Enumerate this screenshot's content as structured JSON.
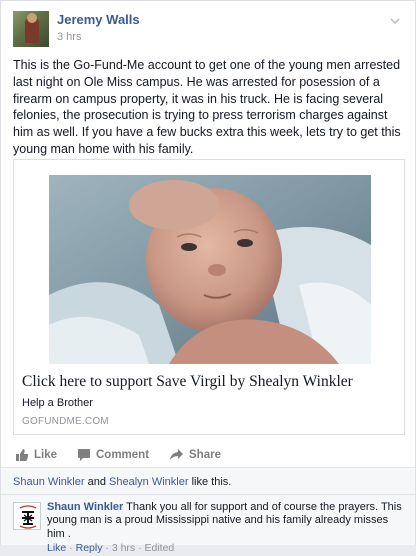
{
  "post": {
    "author": "Jeremy Walls",
    "time": "3 hrs",
    "text": "This is the Go-Fund-Me account to get one of the young men arrested last night on Ole Miss campus. He was arrested for posession of a firearm on campus property, it was in his truck. He is facing several felonies, the prosecution is trying to press terrorism charges against him as well. If you have a few bucks extra this week, lets try to get this young man home with his family."
  },
  "link_card": {
    "title": "Click here to support Save Virgil by Shealyn Winkler",
    "description": "Help a Brother",
    "domain": "GOFUNDME.COM"
  },
  "actions": {
    "like": "Like",
    "comment": "Comment",
    "share": "Share"
  },
  "likes": {
    "person1": "Shaun Winkler",
    "and": "and",
    "person2": "Shealyn Winkler",
    "suffix": "like this."
  },
  "comment": {
    "author": "Shaun Winkler",
    "text": "Thank you all for support and of course the prayers. This young man is a proud Mississippi native and his family already misses him .",
    "like": "Like",
    "sep1": " · ",
    "reply": "Reply",
    "sep2": " · ",
    "time": "3 hrs",
    "sep3": " · ",
    "edited": "Edited"
  },
  "colors": {
    "link_blue": "#3b5998",
    "meta_gray": "#90949c",
    "feedback_bg": "#f6f7f9"
  },
  "icons": [
    "chevron-down-icon",
    "thumbs-up-icon",
    "comment-icon",
    "share-arrow-icon"
  ]
}
